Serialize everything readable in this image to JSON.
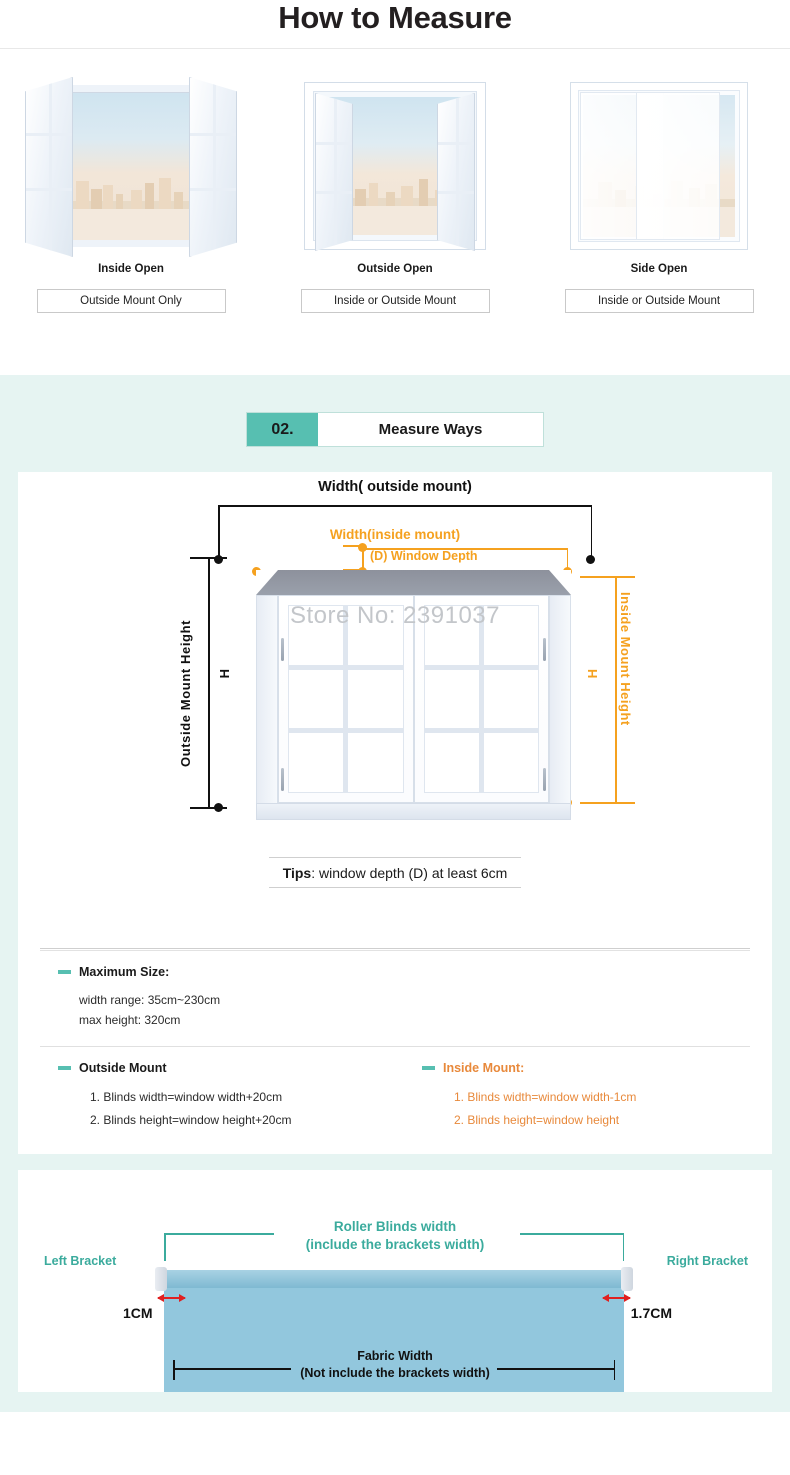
{
  "page": {
    "title": "How to Measure"
  },
  "window_types": [
    {
      "name": "Inside Open",
      "mount": "Outside Mount Only",
      "icon": "window-inside-open-icon"
    },
    {
      "name": "Outside Open",
      "mount": "Inside or Outside Mount",
      "icon": "window-outside-open-icon"
    },
    {
      "name": "Side Open",
      "mount": "Inside or Outside Mount",
      "icon": "window-side-open-icon"
    }
  ],
  "section": {
    "number": "02.",
    "label": "Measure Ways"
  },
  "diagram": {
    "outside_width_label": "Width( outside mount)",
    "inside_width_label": "Width(inside mount)",
    "depth_label": "(D) Window Depth",
    "outside_height_label": "Outside Mount  Height",
    "outside_height_h": "H",
    "inside_height_label": "Inside Mount  Height",
    "inside_height_h": "H",
    "watermark": "Store No: 2391037"
  },
  "tips": {
    "prefix": "Tips",
    "text": ": window depth (D) at least 6cm"
  },
  "max_size": {
    "heading": "Maximum Size:",
    "lines": [
      "width range: 35cm~230cm",
      "max height: 320cm"
    ]
  },
  "outside_mount": {
    "heading": "Outside Mount",
    "items": [
      "1. Blinds width=window width+20cm",
      "2. Blinds height=window height+20cm"
    ]
  },
  "inside_mount": {
    "heading": "Inside Mount:",
    "items": [
      "1. Blinds width=window width-1cm",
      "2. Blinds height=window height"
    ]
  },
  "roller": {
    "width_label_line1": "Roller Blinds width",
    "width_label_line2": "(include the brackets width)",
    "left_bracket": "Left Bracket",
    "right_bracket": "Right Bracket",
    "left_cm": "1CM",
    "right_cm": "1.7CM",
    "fabric_line1": "Fabric Width",
    "fabric_line2": "(Not include the brackets width)"
  },
  "colors": {
    "teal": "#57bfb1",
    "teal_text": "#3bab9d",
    "mint_bg": "#e6f4f2",
    "orange": "#f5a11f",
    "orange_text": "#e8893b",
    "red": "#e02020",
    "fabric_blue": "#92c7dd"
  }
}
